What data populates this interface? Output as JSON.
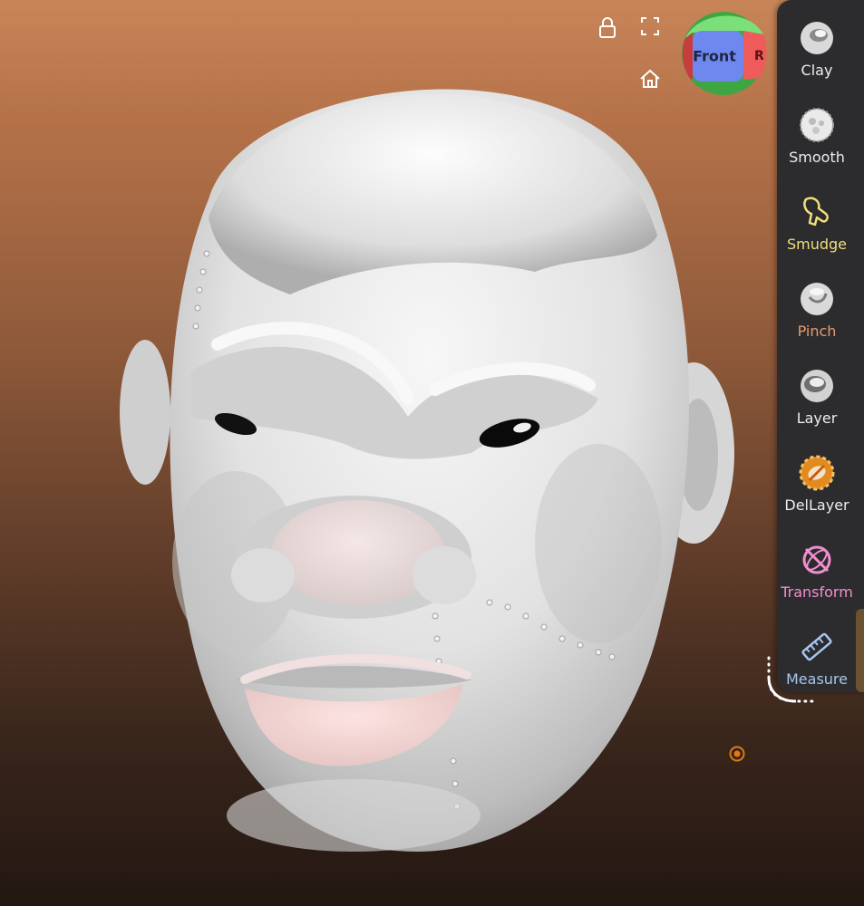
{
  "viewport": {
    "model": "sculpted-head-mesh"
  },
  "overlay": {
    "lock_icon": "lock-icon",
    "fullscreen_icon": "fullscreen-icon",
    "home_icon": "home-icon"
  },
  "view_cube": {
    "front_label": "Front",
    "right_label": "Ri",
    "colors": {
      "front": "#6f88f0",
      "right": "#ef5a5a",
      "top": "#7ce07a",
      "bottom": "#3ea543",
      "left": "#c83c3c"
    }
  },
  "tools": [
    {
      "id": "clay",
      "label": "Clay",
      "icon": "clay-brush-icon",
      "color": "#ececec"
    },
    {
      "id": "smooth",
      "label": "Smooth",
      "icon": "smooth-brush-icon",
      "color": "#ececec"
    },
    {
      "id": "smudge",
      "label": "Smudge",
      "icon": "smudge-brush-icon",
      "color": "#f1df7a"
    },
    {
      "id": "pinch",
      "label": "Pinch",
      "icon": "pinch-brush-icon",
      "color": "#e69a6f"
    },
    {
      "id": "layer",
      "label": "Layer",
      "icon": "layer-brush-icon",
      "color": "#ececec"
    },
    {
      "id": "dellayer",
      "label": "DelLayer",
      "icon": "del-layer-brush-icon",
      "color": "#ececec"
    },
    {
      "id": "transform",
      "label": "Transform",
      "icon": "transform-icon",
      "color": "#f08fcf"
    },
    {
      "id": "measure",
      "label": "Measure",
      "icon": "ruler-icon",
      "color": "#a5c6ee"
    }
  ],
  "pivot_icon": "pivot-target-icon",
  "accent_color": "#e07a10"
}
